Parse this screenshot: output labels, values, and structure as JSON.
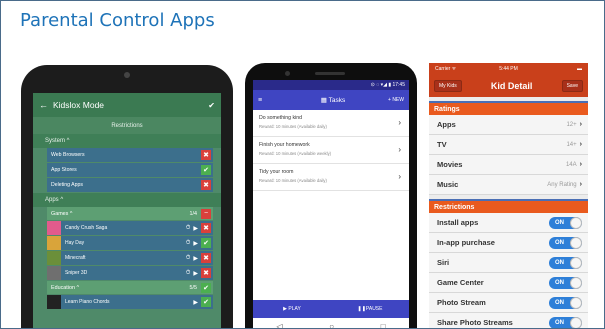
{
  "slide": {
    "title": "Parental Control Apps"
  },
  "tablet": {
    "header": {
      "back_icon": "arrow-left",
      "title": "Kidslox Mode",
      "check_icon": "check"
    },
    "subheader": "Restrictions",
    "system": {
      "label": "System ^",
      "rows": [
        {
          "label": "Web Browsers",
          "state": "x"
        },
        {
          "label": "App Stores",
          "state": "check"
        },
        {
          "label": "Deleting Apps",
          "state": "x"
        }
      ]
    },
    "apps": {
      "label": "Apps ^",
      "games_label": "Games ^",
      "games_count": "1/4",
      "games": [
        {
          "label": "Candy Crush Saga",
          "state": "x"
        },
        {
          "label": "Hay Day",
          "state": "check"
        },
        {
          "label": "Minecraft",
          "state": "x"
        },
        {
          "label": "Sniper 3D",
          "state": "x"
        }
      ],
      "education_label": "Education ^",
      "education_count": "5/5",
      "education": [
        {
          "label": "Learn Piano Chords",
          "state": "check"
        }
      ]
    },
    "colors": {
      "x": "#d9403b",
      "check": "#4caf50"
    }
  },
  "phone": {
    "status": "⊙ ◌ ▾◢ ▮ 17:45",
    "title": "Tasks",
    "new_label": "+ NEW",
    "tasks": [
      {
        "name": "Do something kind",
        "reward": "Reward: 10 minutes (Available daily)"
      },
      {
        "name": "Finish your homework",
        "reward": "Reward: 10 minutes (Available weekly)"
      },
      {
        "name": "Tidy your room",
        "reward": "Reward: 10 minutes (Available daily)"
      }
    ],
    "play_label": "▶ PLAY",
    "pause_label": "❚❚PAUSE"
  },
  "iphone": {
    "status": {
      "carrier": "Carrier ᯤ",
      "time": "5:44 PM",
      "battery": "▬"
    },
    "nav": {
      "left_button": "My Kids",
      "title": "Kid Detail",
      "right_button": "Save"
    },
    "ratings_label": "Ratings",
    "ratings": [
      {
        "label": "Apps",
        "value": "12+"
      },
      {
        "label": "TV",
        "value": "14+"
      },
      {
        "label": "Movies",
        "value": "14A"
      },
      {
        "label": "Music",
        "value": "Any Rating"
      }
    ],
    "restrictions_label": "Restrictions",
    "restrictions": [
      {
        "label": "Install apps",
        "toggle": "ON"
      },
      {
        "label": "In-app purchase",
        "toggle": "ON"
      },
      {
        "label": "Siri",
        "toggle": "ON"
      },
      {
        "label": "Game Center",
        "toggle": "ON"
      },
      {
        "label": "Photo Stream",
        "toggle": "ON"
      },
      {
        "label": "Share Photo Streams",
        "toggle": "ON"
      }
    ]
  }
}
